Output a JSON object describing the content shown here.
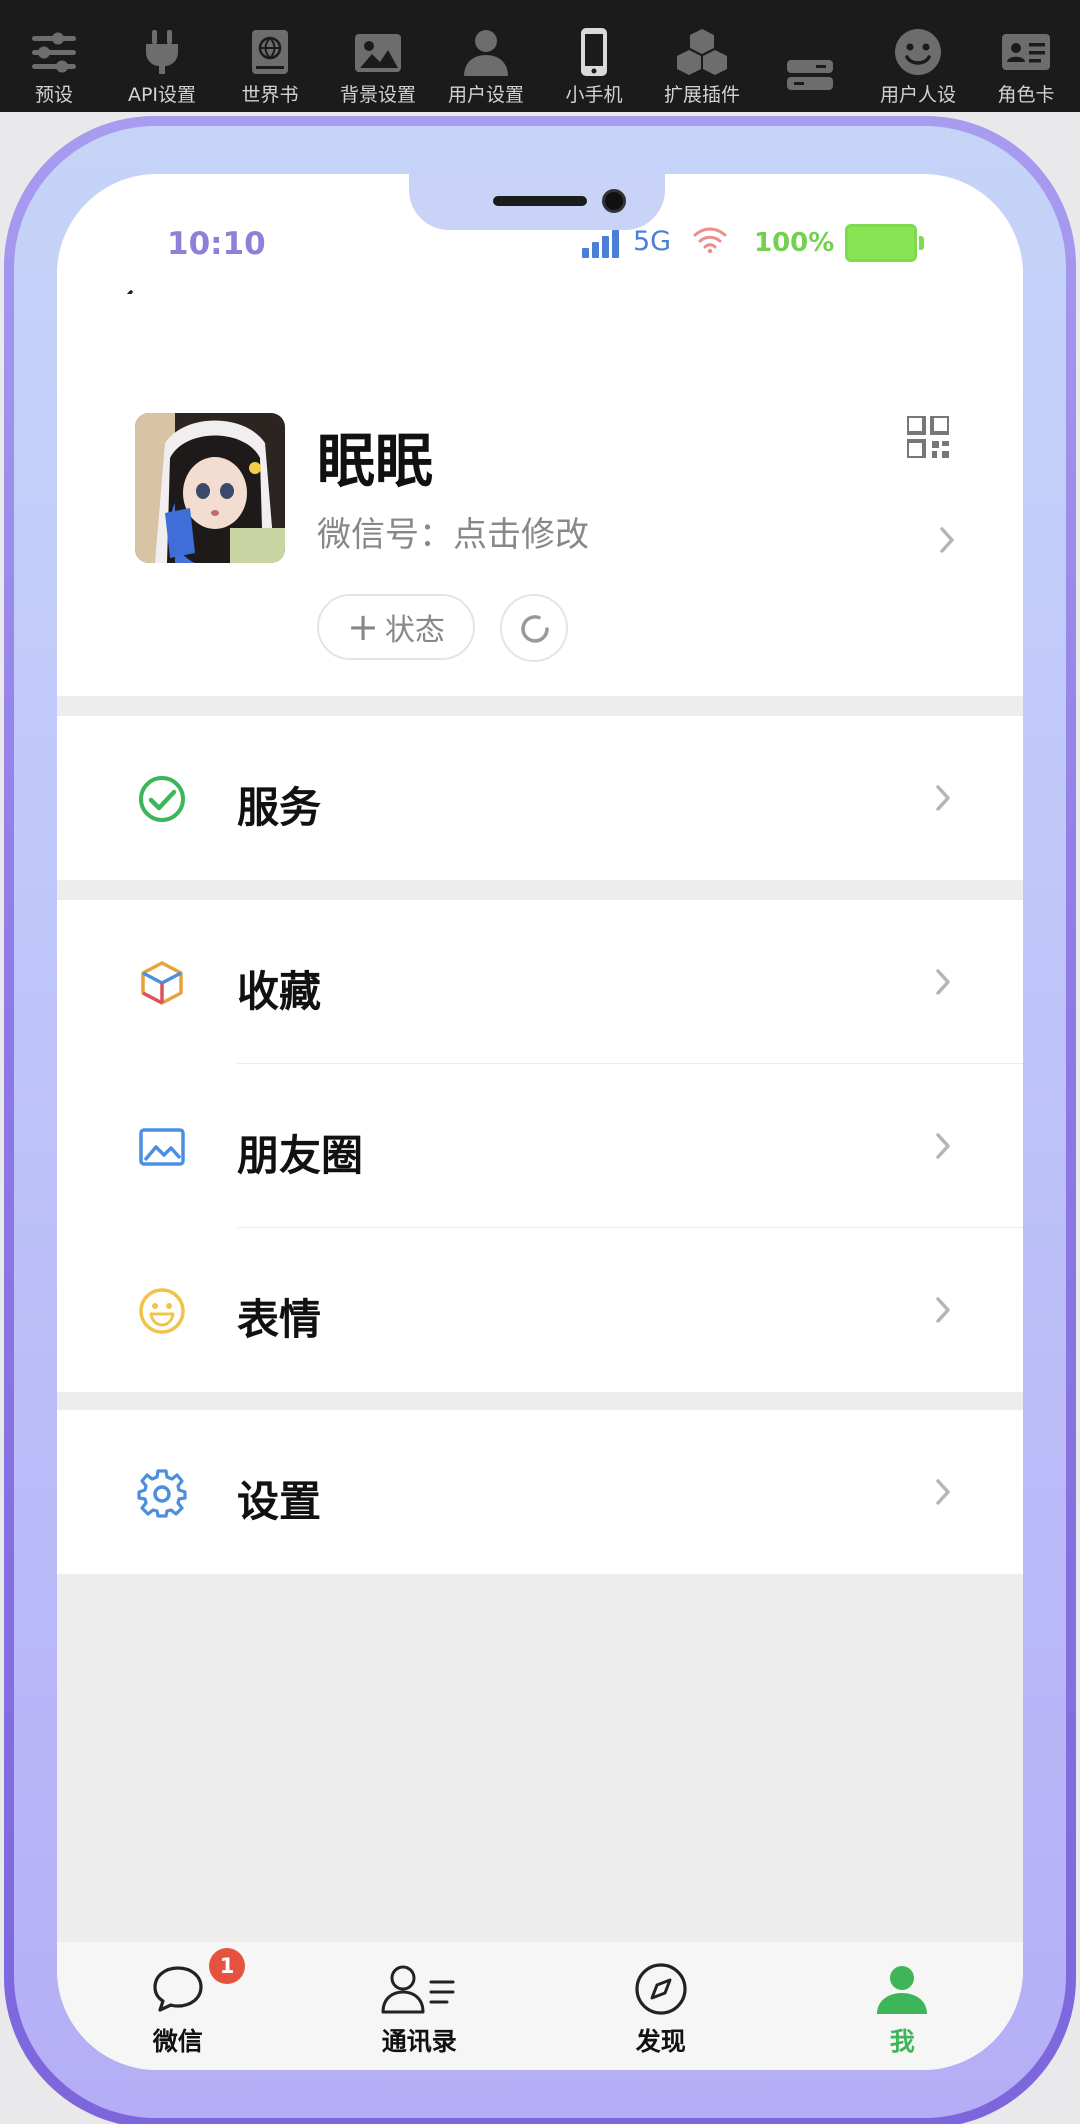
{
  "toolbar": {
    "items": [
      {
        "label": "预设",
        "icon": "sliders-icon"
      },
      {
        "label": "API设置",
        "icon": "plug-icon"
      },
      {
        "label": "世界书",
        "icon": "globe-book-icon"
      },
      {
        "label": "背景设置",
        "icon": "image-icon"
      },
      {
        "label": "用户设置",
        "icon": "user-icon"
      },
      {
        "label": "小手机",
        "icon": "phone-icon"
      },
      {
        "label": "扩展插件",
        "icon": "cubes-icon"
      },
      {
        "label": "",
        "icon": "drawers-icon"
      },
      {
        "label": "用户人设",
        "icon": "smiley-icon"
      },
      {
        "label": "角色卡",
        "icon": "id-card-icon"
      }
    ]
  },
  "status_bar": {
    "time": "10:10",
    "network": "5G",
    "battery": "100%"
  },
  "profile": {
    "name": "眠眠",
    "wechat_id": "微信号：点击修改",
    "status_button": "状态"
  },
  "menu": {
    "group1": [
      {
        "label": "服务",
        "icon": "check-circle-icon"
      }
    ],
    "group2": [
      {
        "label": "收藏",
        "icon": "cube-icon"
      },
      {
        "label": "朋友圈",
        "icon": "picture-icon"
      },
      {
        "label": "表情",
        "icon": "emoji-icon"
      }
    ],
    "group3": [
      {
        "label": "设置",
        "icon": "settings-gear-icon"
      }
    ]
  },
  "tabbar": {
    "tabs": [
      {
        "label": "微信",
        "badge": "1"
      },
      {
        "label": "通讯录"
      },
      {
        "label": "发现"
      },
      {
        "label": "我"
      }
    ]
  },
  "colors": {
    "accent_green": "#3fb55a",
    "frame_purple": "#8e7ae6",
    "time_color": "#8c80d8",
    "badge_red": "#e5533f"
  }
}
